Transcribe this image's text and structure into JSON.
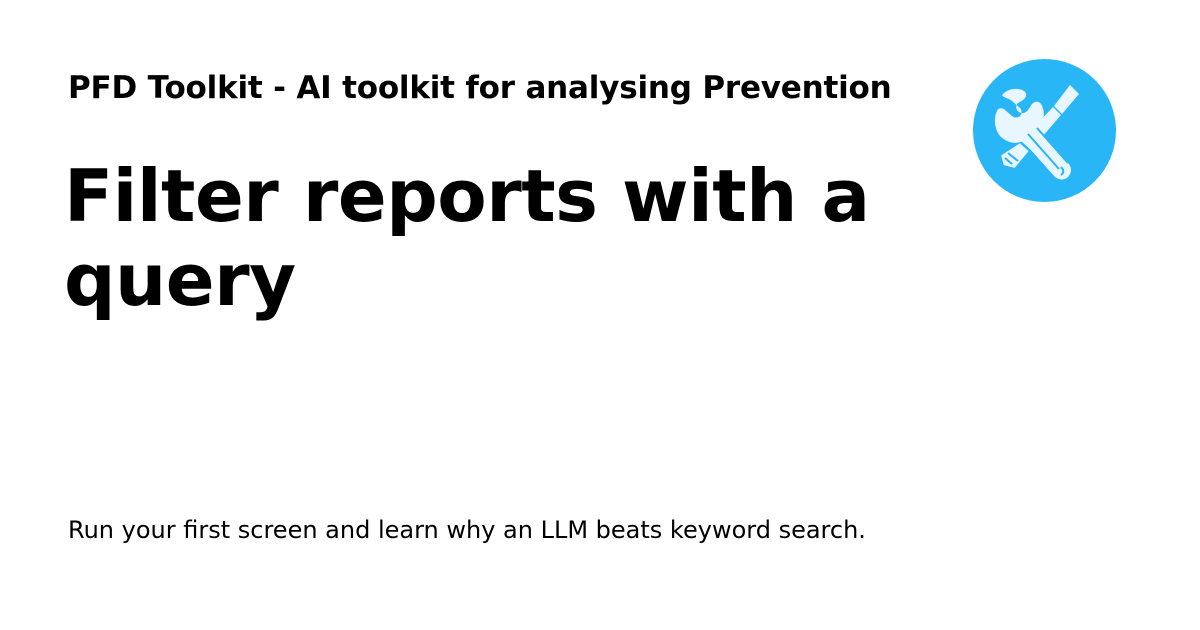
{
  "card": {
    "site_title": "PFD Toolkit - AI toolkit for analysing Prevention",
    "page_title": "Filter reports with a query",
    "description": "Run your first screen and learn why an LLM beats keyword search.",
    "logo_icon": "wrench-screwdriver-icon"
  },
  "colors": {
    "background": "#ffffff",
    "text": "#000000",
    "logo_circle": "#29b6f6",
    "logo_tools": "#e8f7ff"
  }
}
